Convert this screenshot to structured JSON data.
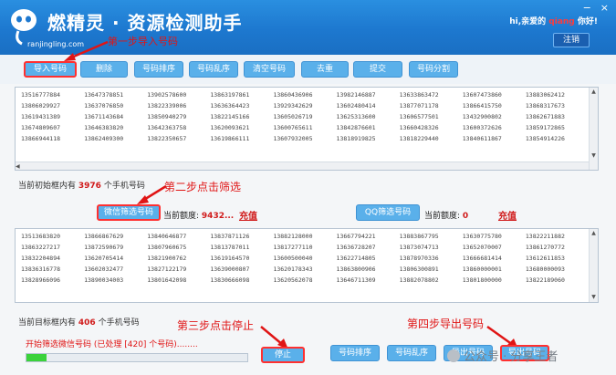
{
  "header": {
    "app_title": "燃精灵 · 资源检测助手",
    "site": "ranjingling.com",
    "greeting_prefix": "hi,亲爱的",
    "username": "qiang",
    "greeting_suffix": "你好!",
    "logout_label": "注销",
    "minimize": "−",
    "close": "×"
  },
  "toolbar": {
    "buttons": [
      "导入号码",
      "删除",
      "号码排序",
      "号码乱序",
      "清空号码",
      "去重",
      "提交",
      "号码分割"
    ]
  },
  "grid_source": {
    "rows": [
      [
        "13516777884",
        "13647378851",
        "13902578600",
        "13863197861",
        "13860436906",
        "13982146887",
        "13633863472",
        "13607473860",
        "13883062412"
      ],
      [
        "13806029927",
        "13637076850",
        "13822339006",
        "13636364423",
        "13929342629",
        "13602480414",
        "13877071178",
        "13866415750",
        "13868317673"
      ],
      [
        "13619431389",
        "13671143684",
        "13850940279",
        "13822145166",
        "13605026719",
        "13625313600",
        "13606577501",
        "13432900802",
        "13862671883"
      ],
      [
        "13674809607",
        "13646383820",
        "13642363758",
        "13620093621",
        "13600765611",
        "13842876601",
        "13660428326",
        "13600372626",
        "13859172865"
      ],
      [
        "13866944118",
        "13862409300",
        "13822350657",
        "13619866111",
        "13607932005",
        "13818919825",
        "13818229440",
        "13840611867",
        "13854914226"
      ]
    ],
    "scroll_up": "▲",
    "scroll_down": "▼",
    "scroll_left": "◀"
  },
  "status_source": {
    "prefix": "当前初始框内有",
    "count": "3976",
    "suffix": "个手机号码"
  },
  "filter_row": {
    "wechat_button": "微信筛选号码",
    "wechat_quota_label": "当前额度:",
    "wechat_quota_value": "9432...",
    "wechat_recharge": "充值",
    "qq_button": "QQ筛选号码",
    "qq_quota_label": "当前额度:",
    "qq_quota_value": "0",
    "qq_recharge": "充值"
  },
  "grid_target": {
    "rows": [
      [
        "13513683820",
        "13866867629",
        "13840646877",
        "13837871126",
        "13882128000",
        "13667794221",
        "13883867795",
        "13630775780",
        "13822211882"
      ],
      [
        "13863227217",
        "13872590679",
        "13807960675",
        "13813787011",
        "13817277110",
        "13636728207",
        "13873074713",
        "13652070007",
        "13861270772"
      ],
      [
        "13832204894",
        "13620705414",
        "13821900762",
        "13619164570",
        "13600500040",
        "13622714805",
        "13878970336",
        "13666681414",
        "13612611853"
      ],
      [
        "13836316778",
        "13602032477",
        "13827122179",
        "13639000807",
        "13620178343",
        "13863800906",
        "13806300891",
        "13860000001",
        "13680000093"
      ],
      [
        "13828966096",
        "13890034003",
        "13801642098",
        "13830666098",
        "13620562078",
        "13646711309",
        "13882078802",
        "13801800000",
        "13822189060"
      ]
    ],
    "scroll_up": "▲",
    "scroll_down": "▼"
  },
  "status_target": {
    "prefix": "当前目标框内有",
    "count": "406",
    "suffix": "个手机号码"
  },
  "progress": {
    "text": "开始筛选微信号码 (已处理 [420] 个号码)........",
    "fraction": 0.09
  },
  "bottom_buttons": {
    "stop": "停止",
    "b2": "号码排序",
    "b3": "号码乱序",
    "b4": "导出号码",
    "b5": "导出号码"
  },
  "annotations": {
    "step1": "第一步导入号码",
    "step2": "第二步点击筛选",
    "step3": "第三步点击停止",
    "step4": "第四步导出号码"
  },
  "watermark": "公众号 · 分享王者",
  "colors": {
    "header_blue": "#1d78cf",
    "button_blue": "#5ab0ea",
    "annotation_red": "#e01515",
    "progress_green": "#3bd23b"
  }
}
